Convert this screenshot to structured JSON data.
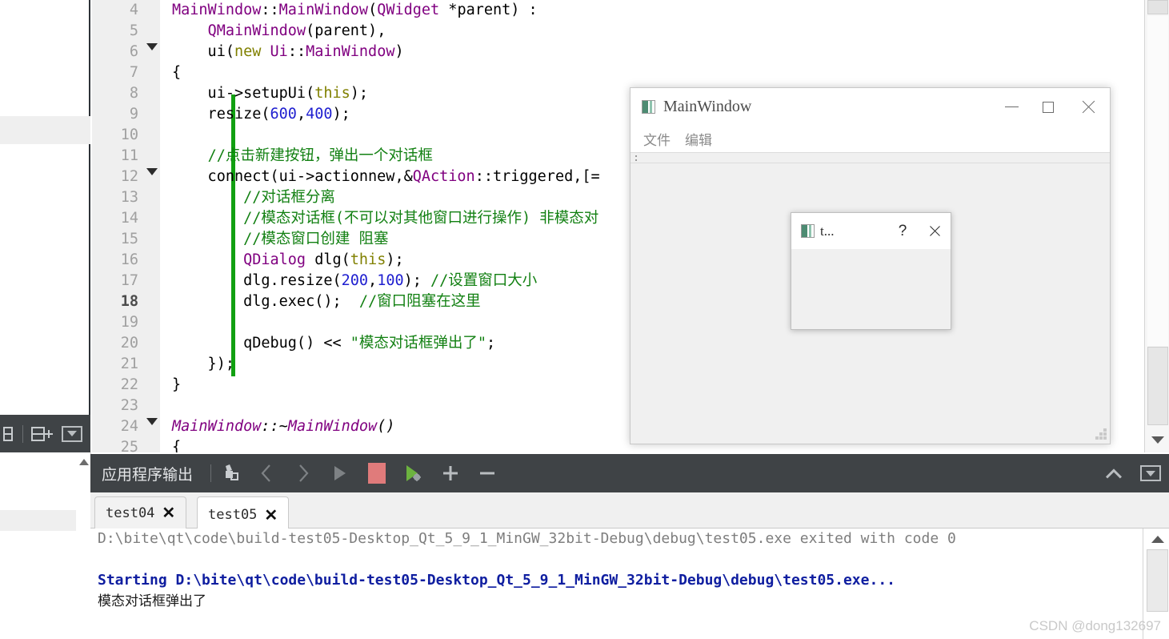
{
  "editor": {
    "lines": [
      {
        "num": "4",
        "fold": false,
        "cur": false,
        "text": "MainWindow::MainWindow(QWidget *parent) :"
      },
      {
        "num": "5",
        "fold": false,
        "cur": false,
        "text": "    QMainWindow(parent),"
      },
      {
        "num": "6",
        "fold": true,
        "cur": false,
        "text": "    ui(new Ui::MainWindow)"
      },
      {
        "num": "7",
        "fold": false,
        "cur": false,
        "text": "{"
      },
      {
        "num": "8",
        "fold": false,
        "cur": false,
        "text": "    ui->setupUi(this);"
      },
      {
        "num": "9",
        "fold": false,
        "cur": false,
        "text": "    resize(600,400);"
      },
      {
        "num": "10",
        "fold": false,
        "cur": false,
        "text": ""
      },
      {
        "num": "11",
        "fold": false,
        "cur": false,
        "text": "    //点击新建按钮，弹出一个对话框"
      },
      {
        "num": "12",
        "fold": true,
        "cur": false,
        "text": "    connect(ui->actionnew,&QAction::triggered,[="
      },
      {
        "num": "13",
        "fold": false,
        "cur": false,
        "text": "        //对话框分离"
      },
      {
        "num": "14",
        "fold": false,
        "cur": false,
        "text": "        //模态对话框(不可以对其他窗口进行操作) 非模态对"
      },
      {
        "num": "15",
        "fold": false,
        "cur": false,
        "text": "        //模态窗口创建 阻塞"
      },
      {
        "num": "16",
        "fold": false,
        "cur": false,
        "text": "        QDialog dlg(this);"
      },
      {
        "num": "17",
        "fold": false,
        "cur": false,
        "text": "        dlg.resize(200,100); //设置窗口大小"
      },
      {
        "num": "18",
        "fold": false,
        "cur": true,
        "text": "        dlg.exec();  //窗口阻塞在这里"
      },
      {
        "num": "19",
        "fold": false,
        "cur": false,
        "text": ""
      },
      {
        "num": "20",
        "fold": false,
        "cur": false,
        "text": "        qDebug() << \"模态对话框弹出了\";"
      },
      {
        "num": "21",
        "fold": false,
        "cur": false,
        "text": "    });"
      },
      {
        "num": "22",
        "fold": false,
        "cur": false,
        "text": "}"
      },
      {
        "num": "23",
        "fold": false,
        "cur": false,
        "text": ""
      },
      {
        "num": "24",
        "fold": true,
        "cur": false,
        "text": "MainWindow::~MainWindow()"
      },
      {
        "num": "25",
        "fold": false,
        "cur": false,
        "text": "{"
      }
    ],
    "change_bar_color": "#11a011"
  },
  "app_window": {
    "title": "MainWindow",
    "icon": "qt-app-icon",
    "menu": [
      "文件",
      "编辑"
    ],
    "minimize": "—",
    "maximize": "□",
    "close": "✕"
  },
  "modal_dialog": {
    "title": "t...",
    "help": "?",
    "close": "✕"
  },
  "output_pane": {
    "title": "应用程序输出",
    "buttons": [
      "clear-output-icon",
      "prev-item-icon",
      "next-item-icon",
      "run-icon",
      "stop-icon",
      "debug-run-icon",
      "zoom-in-icon",
      "zoom-out-icon"
    ],
    "right_buttons": [
      "maximize-pane-icon",
      "pane-menu-icon"
    ],
    "tabs": [
      {
        "label": "test04",
        "close": "✕",
        "active": false
      },
      {
        "label": "test05",
        "close": "✕",
        "active": true
      }
    ],
    "console": [
      {
        "style": "gray",
        "text": "D:\\bite\\qt\\code\\build-test05-Desktop_Qt_5_9_1_MinGW_32bit-Debug\\debug\\test05.exe exited with code 0"
      },
      {
        "style": "blank",
        "text": ""
      },
      {
        "style": "blue",
        "text": "Starting D:\\bite\\qt\\code\\build-test05-Desktop_Qt_5_9_1_MinGW_32bit-Debug\\debug\\test05.exe..."
      },
      {
        "style": "black",
        "text": "模态对话框弹出了"
      }
    ]
  },
  "left_toolbar": {
    "buttons": [
      "split-icon",
      "split-add-icon",
      "view-menu-icon"
    ]
  },
  "watermark": "CSDN @dong132697",
  "colors": {
    "toolbar_bg": "#3f4346",
    "gutter_bg": "#efefef",
    "comment": "#128012",
    "type": "#800080",
    "number": "#2020d0",
    "console_blue": "#0f1ea0"
  }
}
